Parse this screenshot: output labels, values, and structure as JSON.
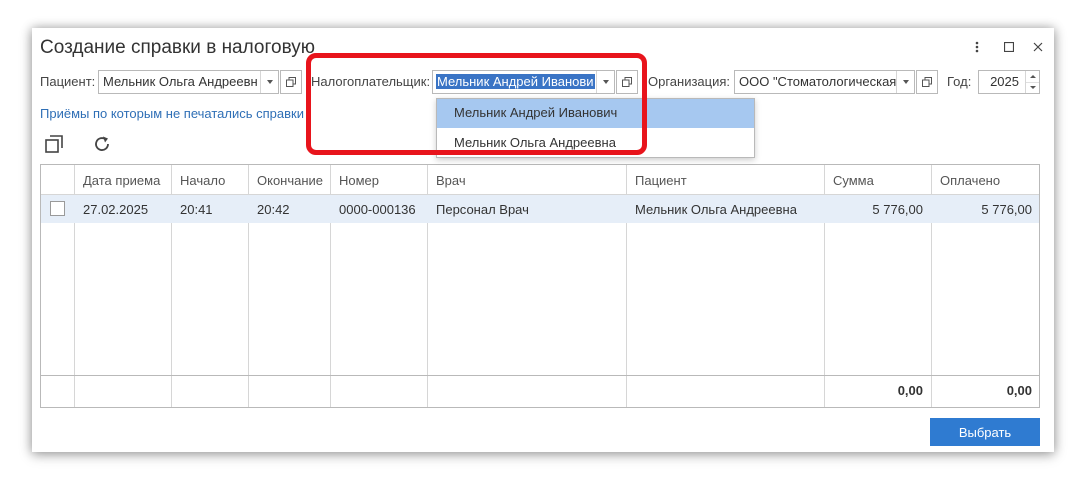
{
  "window": {
    "title": "Создание справки в налоговую"
  },
  "filters": {
    "patient_label": "Пациент:",
    "patient_value": "Мельник Ольга Андреевн",
    "taxpayer_label": "Налогоплательщик:",
    "taxpayer_value": "Мельник Андрей Иванови",
    "organization_label": "Организация:",
    "organization_value": "ООО \"Стоматологическая",
    "year_label": "Год:",
    "year_value": "2025"
  },
  "link_text": "Приёмы по которым не печатались справки",
  "dropdown": {
    "options": [
      "Мельник Андрей Иванович",
      "Мельник Ольга Андреевна"
    ],
    "selected_index": 0
  },
  "table": {
    "columns": [
      "",
      "Дата приема",
      "Начало",
      "Окончание",
      "Номер",
      "Врач",
      "Пациент",
      "Сумма",
      "Оплачено"
    ],
    "rows": [
      {
        "checked": false,
        "date": "27.02.2025",
        "start": "20:41",
        "end": "20:42",
        "number": "0000-000136",
        "doctor": "Персонал Врач",
        "patient": "Мельник Ольга Андреевна",
        "sum": "5 776,00",
        "paid": "5 776,00"
      }
    ],
    "totals": {
      "sum": "0,00",
      "paid": "0,00"
    }
  },
  "buttons": {
    "select_label": "Выбрать"
  },
  "colors": {
    "accent": "#2f7bd1",
    "row_highlight": "#e6eef8",
    "dropdown_highlight": "#a6c8f0",
    "annotation_red": "#e8141c",
    "link": "#2f6fb6"
  },
  "icons": [
    "more-vert-icon",
    "maximize-icon",
    "close-icon",
    "dropdown-arrow-icon",
    "open-form-icon",
    "copy-icon",
    "refresh-icon",
    "spinner-up-icon",
    "spinner-down-icon"
  ]
}
